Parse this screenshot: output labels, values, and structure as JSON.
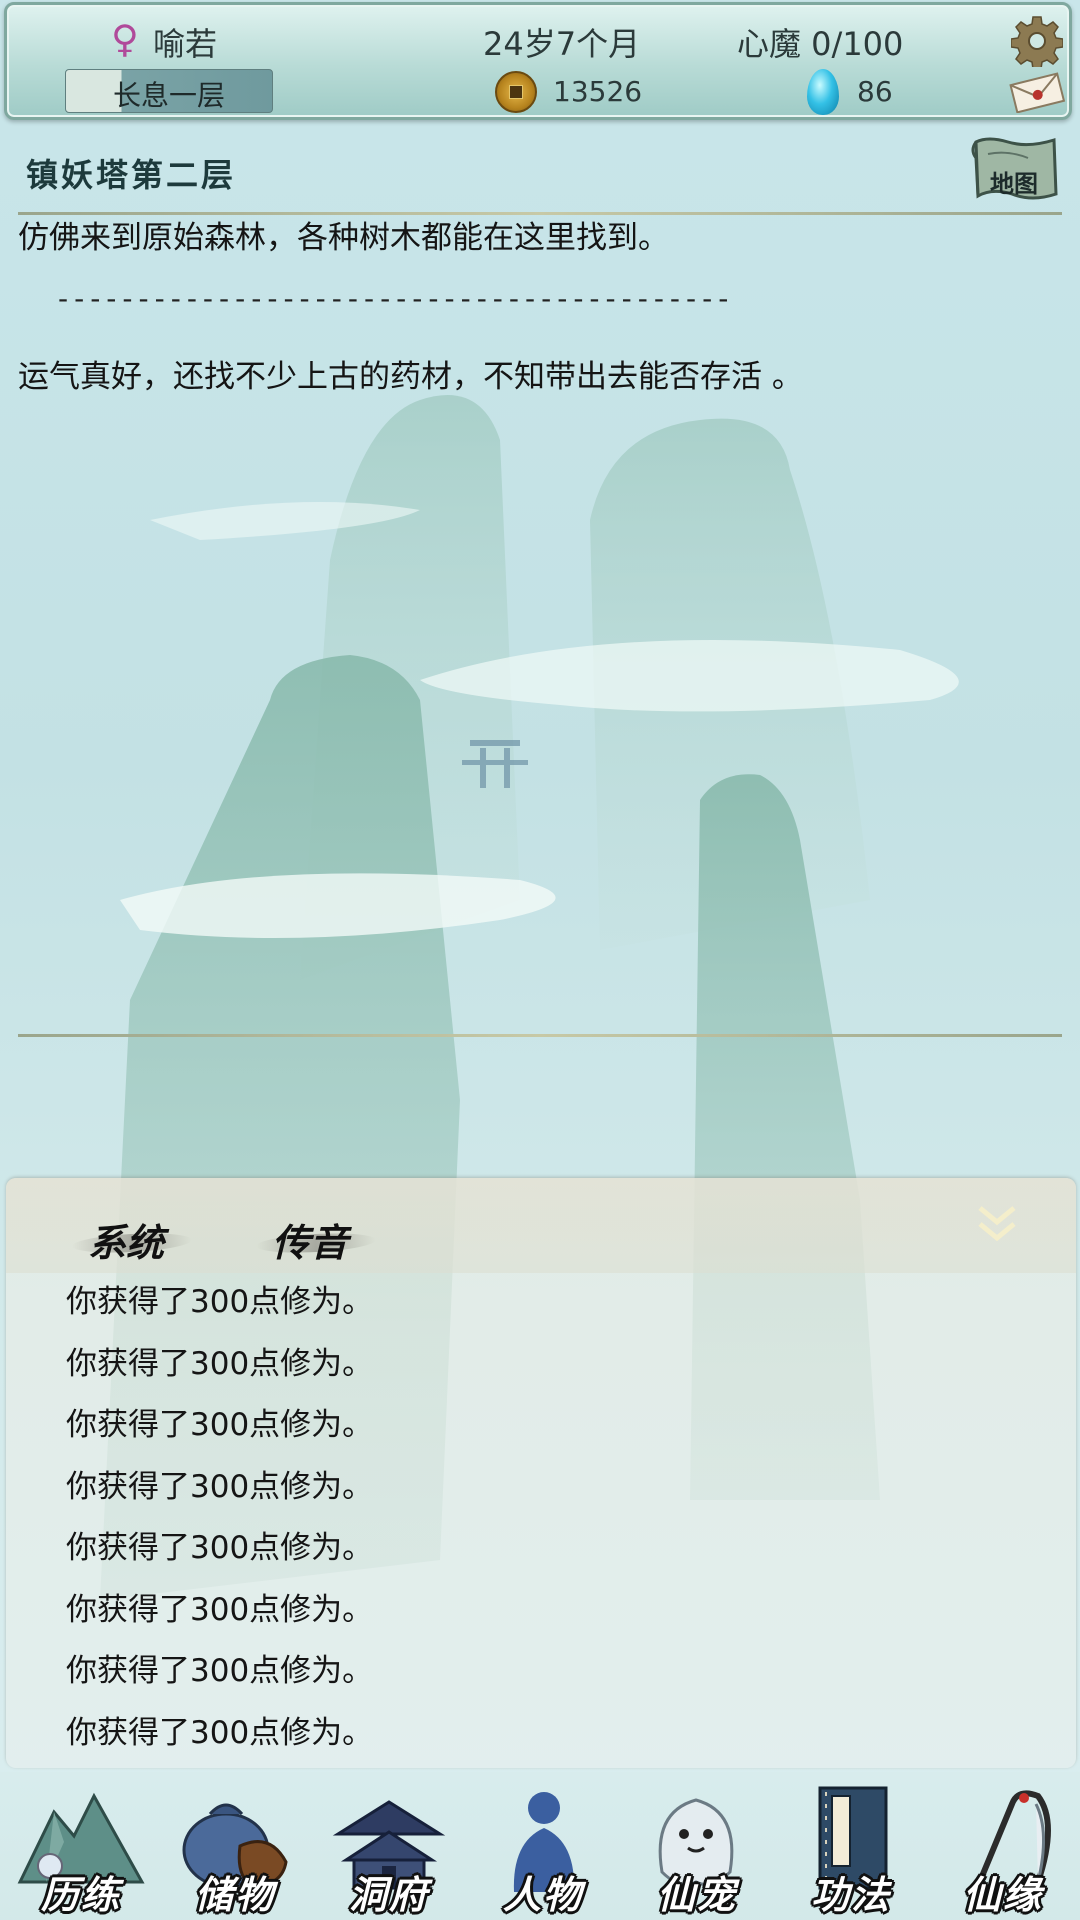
{
  "status": {
    "gender_symbol": "♀",
    "player_name": "喻若",
    "realm": "长息一层",
    "age": "24岁7个月",
    "heart_demon": "心魔  0/100",
    "coins": "13526",
    "gems": "86"
  },
  "location": {
    "title": "镇妖塔第二层",
    "map_button": "地图"
  },
  "story": {
    "line1": "仿佛来到原始森林，各种树木都能在这里找到。",
    "separator": "------------------------------------------",
    "line2": "运气真好，还找不少上古的药材，不知带出去能否存活 。"
  },
  "messages": {
    "tab_system": "系统",
    "tab_transmission": "传音",
    "items": [
      "你获得了300点修为。",
      "你获得了300点修为。",
      "你获得了300点修为。",
      "你获得了300点修为。",
      "你获得了300点修为。",
      "你获得了300点修为。",
      "你获得了300点修为。",
      "你获得了300点修为。"
    ]
  },
  "nav": {
    "items": [
      {
        "label": "历练",
        "icon": "mountain-icon"
      },
      {
        "label": "储物",
        "icon": "storage-bag-icon"
      },
      {
        "label": "洞府",
        "icon": "pavilion-icon"
      },
      {
        "label": "人物",
        "icon": "character-icon"
      },
      {
        "label": "仙宠",
        "icon": "spirit-pet-icon"
      },
      {
        "label": "功法",
        "icon": "scripture-book-icon"
      },
      {
        "label": "仙缘",
        "icon": "crane-icon"
      }
    ]
  },
  "colors": {
    "background": "#c6e3e6",
    "top_bar": "#b8dbd6",
    "mountain": "#8fbdb1",
    "accent_gold": "#b7841e",
    "gem_blue": "#34c1e6"
  }
}
